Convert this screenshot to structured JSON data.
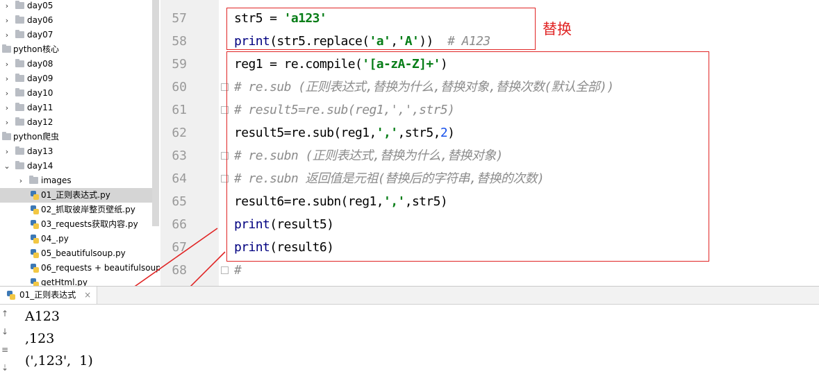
{
  "project_tree": {
    "items": [
      {
        "label": "day05",
        "type": "folder",
        "expanded": false,
        "depth": 1
      },
      {
        "label": "day06",
        "type": "folder",
        "expanded": false,
        "depth": 1
      },
      {
        "label": "day07",
        "type": "folder",
        "expanded": false,
        "depth": 1
      },
      {
        "label": "python核心",
        "type": "folder",
        "expanded": true,
        "depth": 0
      },
      {
        "label": "day08",
        "type": "folder",
        "expanded": false,
        "depth": 1
      },
      {
        "label": "day09",
        "type": "folder",
        "expanded": false,
        "depth": 1
      },
      {
        "label": "day10",
        "type": "folder",
        "expanded": false,
        "depth": 1
      },
      {
        "label": "day11",
        "type": "folder",
        "expanded": false,
        "depth": 1
      },
      {
        "label": "day12",
        "type": "folder",
        "expanded": false,
        "depth": 1
      },
      {
        "label": "python爬虫",
        "type": "folder",
        "expanded": true,
        "depth": 0
      },
      {
        "label": "day13",
        "type": "folder",
        "expanded": false,
        "depth": 1
      },
      {
        "label": "day14",
        "type": "folder",
        "expanded": true,
        "depth": 1
      },
      {
        "label": "images",
        "type": "folder",
        "expanded": false,
        "depth": 2
      },
      {
        "label": "01_正则表达式.py",
        "type": "file",
        "selected": true,
        "depth": 2
      },
      {
        "label": "02_抓取彼岸整页壁纸.py",
        "type": "file",
        "depth": 2
      },
      {
        "label": "03_requests获取内容.py",
        "type": "file",
        "depth": 2
      },
      {
        "label": "04_.py",
        "type": "file",
        "depth": 2
      },
      {
        "label": "05_beautifulsoup.py",
        "type": "file",
        "depth": 2
      },
      {
        "label": "06_requests + beautifulsoup.",
        "type": "file",
        "depth": 2
      },
      {
        "label": "getHtml.py",
        "type": "file",
        "depth": 2
      }
    ]
  },
  "editor": {
    "line_numbers": [
      "57",
      "58",
      "59",
      "60",
      "61",
      "62",
      "63",
      "64",
      "65",
      "66",
      "67",
      "68"
    ],
    "lines": [
      [
        {
          "t": "str5 = ",
          "c": ""
        },
        {
          "t": "'a123'",
          "c": "str"
        }
      ],
      [
        {
          "t": "print",
          "c": "kw"
        },
        {
          "t": "(str5.replace(",
          "c": ""
        },
        {
          "t": "'a'",
          "c": "str"
        },
        {
          "t": ",",
          "c": ""
        },
        {
          "t": "'A'",
          "c": "str"
        },
        {
          "t": "))  ",
          "c": ""
        },
        {
          "t": "# A123",
          "c": "cmt"
        }
      ],
      [
        {
          "t": "reg1 = re.compile(",
          "c": ""
        },
        {
          "t": "'[a-zA-Z]+'",
          "c": "str"
        },
        {
          "t": ")",
          "c": ""
        }
      ],
      [
        {
          "t": "# re.sub (正则表达式,替换为什么,替换对象,替换次数(默认全部))",
          "c": "cmt"
        }
      ],
      [
        {
          "t": "# result5=re.sub(reg1,',',str5)",
          "c": "cmt"
        }
      ],
      [
        {
          "t": "result5=re.sub(reg1,",
          "c": ""
        },
        {
          "t": "','",
          "c": "str"
        },
        {
          "t": ",str5,",
          "c": ""
        },
        {
          "t": "2",
          "c": "num"
        },
        {
          "t": ")",
          "c": ""
        }
      ],
      [
        {
          "t": "# re.subn (正则表达式,替换为什么,替换对象)",
          "c": "cmt"
        }
      ],
      [
        {
          "t": "# re.subn 返回值是元祖(替换后的字符串,替换的次数)",
          "c": "cmt"
        }
      ],
      [
        {
          "t": "result6=re.subn(reg1,",
          "c": ""
        },
        {
          "t": "','",
          "c": "str"
        },
        {
          "t": ",str5)",
          "c": ""
        }
      ],
      [
        {
          "t": "print",
          "c": "kw"
        },
        {
          "t": "(result5)",
          "c": ""
        }
      ],
      [
        {
          "t": "print",
          "c": "kw"
        },
        {
          "t": "(result6)",
          "c": ""
        }
      ],
      [
        {
          "t": "#",
          "c": "cmt"
        }
      ]
    ],
    "annotation_label": "替换",
    "annotation_color": "#e02424"
  },
  "run_panel": {
    "tab_label": "01_正则表达式",
    "close_symbol": "×",
    "tools": [
      "up-arrow-icon",
      "down-arrow-icon",
      "soft-wrap-icon",
      "scroll-to-end-icon"
    ],
    "output": [
      "A123",
      ",123",
      "(',123',  1)"
    ]
  }
}
